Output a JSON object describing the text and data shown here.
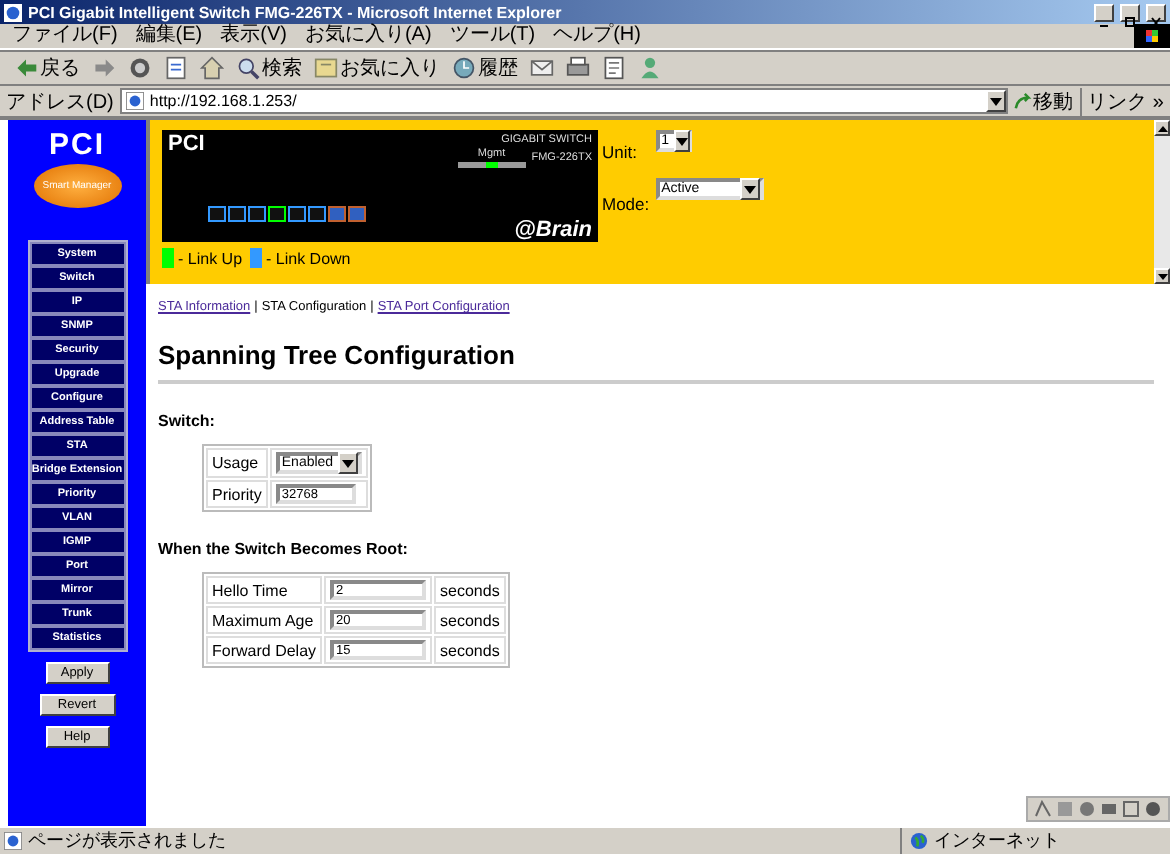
{
  "window": {
    "title": "PCI Gigabit Intelligent Switch FMG-226TX - Microsoft Internet Explorer"
  },
  "menu": [
    "ファイル(F)",
    "編集(E)",
    "表示(V)",
    "お気に入り(A)",
    "ツール(T)",
    "ヘルプ(H)"
  ],
  "toolbar": [
    {
      "kind": "back",
      "label": "戻る"
    },
    {
      "kind": "forward"
    },
    {
      "kind": "stop"
    },
    {
      "kind": "refresh"
    },
    {
      "kind": "home"
    },
    {
      "kind": "search",
      "label": "検索"
    },
    {
      "kind": "favorites",
      "label": "お気に入り"
    },
    {
      "kind": "history",
      "label": "履歴"
    },
    {
      "kind": "mail"
    },
    {
      "kind": "print"
    },
    {
      "kind": "edit"
    },
    {
      "kind": "messenger"
    }
  ],
  "address_bar": {
    "label": "アドレス(D)",
    "url": "http://192.168.1.253/",
    "go": "移動",
    "links": "リンク »"
  },
  "sidebar": {
    "logo": "PCI",
    "badge": "Smart Manager",
    "items": [
      {
        "label": "System"
      },
      {
        "label": "Switch"
      },
      {
        "label": "IP"
      },
      {
        "label": "SNMP"
      },
      {
        "label": "Security"
      },
      {
        "label": "Upgrade"
      },
      {
        "label": "Configure"
      },
      {
        "label": "Address Table"
      },
      {
        "label": "STA"
      },
      {
        "label": "Bridge Extension"
      },
      {
        "label": "Priority"
      },
      {
        "label": "VLAN"
      },
      {
        "label": "IGMP"
      },
      {
        "label": "Port"
      },
      {
        "label": "Mirror"
      },
      {
        "label": "Trunk"
      },
      {
        "label": "Statistics"
      }
    ],
    "buttons": [
      "Apply",
      "Revert",
      "Help"
    ]
  },
  "header": {
    "logo": "PCI",
    "model": "GIGABIT SWITCH",
    "mgmt": "Mgmt",
    "model_number": "FMG-226TX",
    "brand": "@Brain",
    "ports": [
      {
        "kind": "copper",
        "link_up": false
      },
      {
        "kind": "copper",
        "link_up": false
      },
      {
        "kind": "copper",
        "link_up": false
      },
      {
        "kind": "copper",
        "link_up": true
      },
      {
        "kind": "copper",
        "link_up": false
      },
      {
        "kind": "copper",
        "link_up": false
      },
      {
        "kind": "fiber",
        "link_up": false
      },
      {
        "kind": "fiber",
        "link_up": false
      }
    ],
    "unit": {
      "label": "Unit:",
      "value": "1"
    },
    "mode": {
      "label": "Mode:",
      "value": "Active"
    },
    "legend": [
      {
        "label": "- Link Up",
        "color": "#00ff00"
      },
      {
        "label": "- Link Down",
        "color": "#3399ff"
      }
    ]
  },
  "nav": [
    {
      "kind": "link",
      "label": "STA Information"
    },
    {
      "kind": "separator",
      "label": "|"
    },
    {
      "kind": "current",
      "label": "STA Configuration"
    },
    {
      "kind": "separator",
      "label": "|"
    },
    {
      "kind": "link",
      "label": "STA Port Configuration"
    }
  ],
  "heading": "Spanning Tree Configuration",
  "sections": [
    {
      "title": "Switch:",
      "rows": [
        {
          "label": "Usage",
          "kind": "select",
          "value": "Enabled"
        },
        {
          "label": "Priority",
          "kind": "input",
          "value": "32768"
        }
      ]
    },
    {
      "title": "When the Switch Becomes Root:",
      "rows": [
        {
          "label": "Hello Time",
          "kind": "input",
          "value": "2",
          "unit": "seconds"
        },
        {
          "label": "Maximum Age",
          "kind": "input",
          "value": "20",
          "unit": "seconds"
        },
        {
          "label": "Forward Delay",
          "kind": "input",
          "value": "15",
          "unit": "seconds"
        }
      ]
    }
  ],
  "status_bar": {
    "text": "ページが表示されました",
    "zone": "インターネット"
  }
}
